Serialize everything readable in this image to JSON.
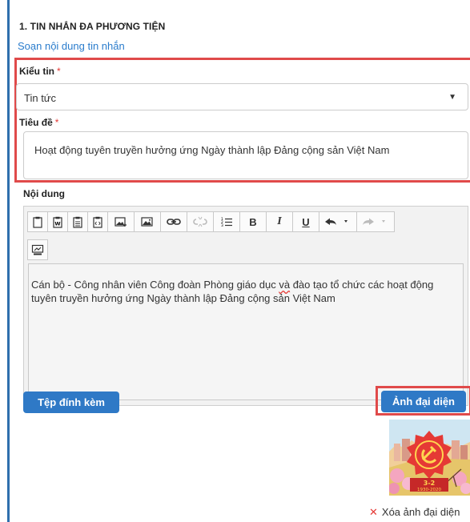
{
  "section": {
    "title": "1. TIN NHẮN ĐA PHƯƠNG TIỆN",
    "compose_link": "Soạn nội dung tin nhắn"
  },
  "fields": {
    "type_label": "Kiểu tin",
    "type_value": "Tin tức",
    "title_label": "Tiêu đề",
    "title_value": "Hoạt động tuyên truyền hưởng ứng Ngày thành lập Đảng cộng sản Việt Nam",
    "content_label": "Nội dung",
    "required_mark": "*"
  },
  "editor": {
    "text_a": "Cán bộ - Công nhân viên Công đoàn Phòng giáo dục ",
    "text_b": "và",
    "text_c": " đào tạo tổ chức các hoạt động tuyên truyền hưởng ứng Ngày thành lập Đảng cộng sản Việt Nam",
    "toolbar": {
      "bold": "B",
      "italic": "I",
      "underline": "U"
    }
  },
  "buttons": {
    "attach": "Tệp đính kèm",
    "avatar": "Ảnh đại diện",
    "remove_avatar": "Xóa ảnh đại diện",
    "remove_icon": "✕"
  },
  "thumbnail": {
    "badge": "3-2",
    "years": "1930-2020"
  },
  "colors": {
    "accent": "#2f79c6",
    "highlight": "#e04a4a",
    "link": "#2a7ccc"
  }
}
